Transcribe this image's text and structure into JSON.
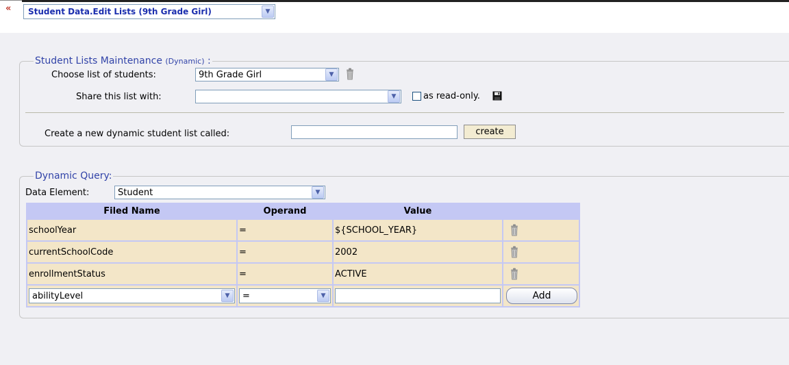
{
  "header": {
    "collapse_glyph": "«",
    "page_selector_value": "Student Data.Edit Lists (9th Grade Girl)"
  },
  "maintenance": {
    "legend_main": "Student Lists Maintenance ",
    "legend_small": "(Dynamic)",
    "legend_suffix": " :",
    "choose_label": "Choose list of students:",
    "choose_value": "9th Grade Girl",
    "share_label": "Share this list with:",
    "share_value": "",
    "readonly_label": "as read-only.",
    "readonly_checked": false,
    "create_label": "Create a new dynamic student list called:",
    "create_input_value": "",
    "create_button": "create"
  },
  "query": {
    "legend": "Dynamic Query:",
    "data_element_label": "Data Element:",
    "data_element_value": "Student",
    "columns": [
      "Filed Name",
      "Operand",
      "Value"
    ],
    "rows": [
      {
        "field": "schoolYear",
        "operand": "=",
        "value": "${SCHOOL_YEAR}"
      },
      {
        "field": "currentSchoolCode",
        "operand": "=",
        "value": "2002"
      },
      {
        "field": "enrollmentStatus",
        "operand": "=",
        "value": "ACTIVE"
      }
    ],
    "new_row": {
      "field": "abilityLevel",
      "operand": "=",
      "value": "",
      "add_button": "Add"
    }
  },
  "icons": {
    "trash": "trash-can-icon",
    "save": "floppy-disk-icon",
    "dropdown": "chevron-down-icon"
  },
  "colors": {
    "accent": "#3143a8",
    "link": "#1a2eae",
    "header_row": "#c4c8f4",
    "data_row": "#f3e6c8",
    "panel_bg": "#f0f0f4"
  }
}
